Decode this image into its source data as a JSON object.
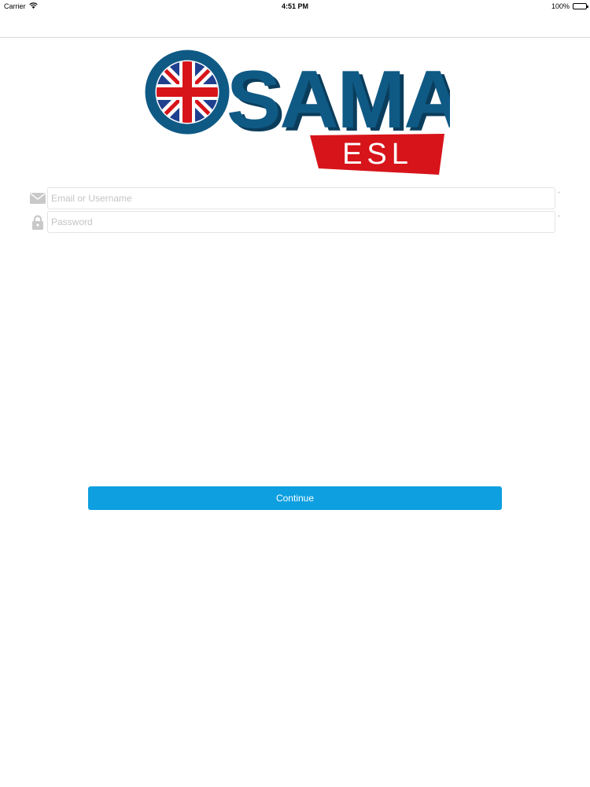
{
  "status_bar": {
    "carrier": "Carrier",
    "time": "4:51 PM",
    "battery": "100%",
    "battery_level": 1.0
  },
  "logo": {
    "word": "OSAMA",
    "subword": "ESL",
    "colors": {
      "blue": "#0f5a85",
      "dark_blue": "#0a3d5c",
      "red": "#d7141a",
      "flag_blue": "#1f3f8f"
    }
  },
  "login_form": {
    "email": {
      "placeholder": "Email or Username",
      "value": "",
      "icon": "envelope-icon",
      "required_mark": "*"
    },
    "password": {
      "placeholder": "Password",
      "value": "",
      "icon": "lock-icon",
      "required_mark": "*"
    }
  },
  "continue_button": {
    "label": "Continue",
    "color": "#0d9fe0"
  }
}
